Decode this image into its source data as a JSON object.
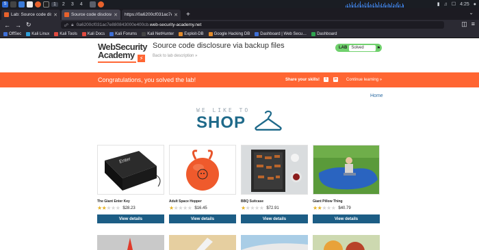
{
  "taskbar": {
    "workspaces": [
      "1",
      "2",
      "3",
      "4"
    ],
    "clock": "4:25"
  },
  "browser": {
    "tabs": [
      {
        "title": "Lab: Source code disclos…",
        "active": false
      },
      {
        "title": "Source code disclosure vi…",
        "active": true
      },
      {
        "title": "https://0a6200cf031ac7e88…",
        "active": false
      }
    ],
    "new_tab": "+",
    "url_prefix": "0a6200cf031ac7e880843000e400cb.",
    "url_host": "web-security-academy.net",
    "bookmarks": [
      {
        "label": "OffSec",
        "color": "#3d6fd6"
      },
      {
        "label": "Kali Linux",
        "color": "#2f9fd8"
      },
      {
        "label": "Kali Tools",
        "color": "#e04a3f"
      },
      {
        "label": "Kali Docs",
        "color": "#e04a3f"
      },
      {
        "label": "Kali Forums",
        "color": "#3d6fd6"
      },
      {
        "label": "Kali NetHunter",
        "color": "#444"
      },
      {
        "label": "Exploit-DB",
        "color": "#e38b2a"
      },
      {
        "label": "Google Hacking DB",
        "color": "#e38b2a"
      },
      {
        "label": "Dashboard | Web Secu…",
        "color": "#3d6fd6"
      },
      {
        "label": "Dashboard",
        "color": "#2ea44f"
      }
    ]
  },
  "header": {
    "logo_line1": "WebSecurity",
    "logo_line2": "Academy",
    "lab_title": "Source code disclosure via backup files",
    "back_link": "Back to lab description »",
    "status_label": "LAB",
    "status_value": "Solved"
  },
  "banner": {
    "message": "Congratulations, you solved the lab!",
    "share": "Share your skills!",
    "continue": "Continue learning »",
    "color": "#ff6633"
  },
  "nav": {
    "home": "Home"
  },
  "hero": {
    "tagline": "WE LIKE TO",
    "title": "SHOP"
  },
  "products": [
    {
      "name": "The Giant Enter Key",
      "rating": 2,
      "price": "$28.23",
      "button": "View details"
    },
    {
      "name": "Adult Space Hopper",
      "rating": 1,
      "price": "$16.45",
      "button": "View details"
    },
    {
      "name": "BBQ Suitcase",
      "rating": 1,
      "price": "$72.91",
      "button": "View details"
    },
    {
      "name": "Giant Pillow Thing",
      "rating": 2,
      "price": "$40.79",
      "button": "View details"
    }
  ],
  "colors": {
    "button": "#1c5d85",
    "accent": "#ff6633",
    "star": "#e4b123"
  }
}
